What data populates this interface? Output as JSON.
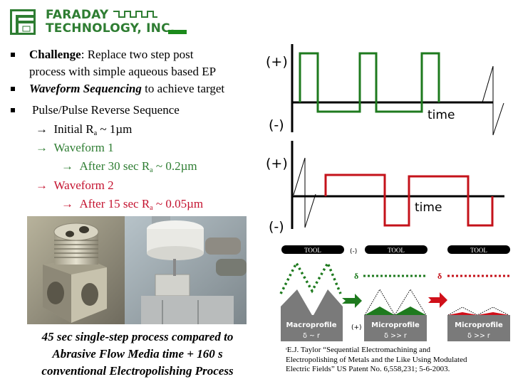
{
  "logo": {
    "line1": "FARADAY",
    "line2": "TECHNOLOGY, INC.",
    "brand_color": "#2e7d32"
  },
  "bullets": [
    {
      "bold": "Challenge",
      "rest": ": Replace two step post",
      "cont": "process with simple aqueous based EP"
    },
    {
      "emph": "Waveform Sequencing",
      "rest": " to achieve target"
    },
    {
      "text": "Pulse/Pulse Reverse Sequence"
    }
  ],
  "sub_items": {
    "arrow": "→",
    "initial": {
      "pre": "Initial R",
      "sub": "a",
      "post": " ~ 1µm"
    },
    "waveform1": {
      "label": "Waveform 1",
      "pre": "After 30 sec R",
      "sub": "a",
      "post": " ~ 0.2µm",
      "color": "#2e7d32"
    },
    "waveform2": {
      "label": "Waveform 2",
      "pre": "After 15 sec R",
      "sub": "a",
      "post": " ~ 0.05µm",
      "color": "#c4122f"
    }
  },
  "caption": {
    "line1": "45 sec single-step process compared to",
    "line2": "Abrasive Flow Media time + 160 s",
    "line3": "conventional Electropolishing Process"
  },
  "waveform_top": {
    "plus": "(+)",
    "minus": "(-)",
    "axis_label": "time",
    "color": "#1e7a1e"
  },
  "waveform_bottom": {
    "plus": "(+)",
    "minus": "(-)",
    "axis_label": "time",
    "color": "#c4121a"
  },
  "diagram": {
    "tool_label": "TOOL",
    "minus": "(-)",
    "plus": "(+)",
    "delta": "δ",
    "panels": [
      {
        "title": "Macroprofile",
        "relation": "δ ~ r"
      },
      {
        "title": "Microprofile",
        "relation": "δ >> r"
      },
      {
        "title": "Microprofile",
        "relation": "δ >> r"
      }
    ]
  },
  "reference": {
    "line1": "ᶦE.J. Taylor “Sequential Electromachining and",
    "line2": "Electropolishing of Metals and the Like Using Modulated",
    "line3": "Electric Fields” US Patent No. 6,558,231; 5-6-2003."
  }
}
